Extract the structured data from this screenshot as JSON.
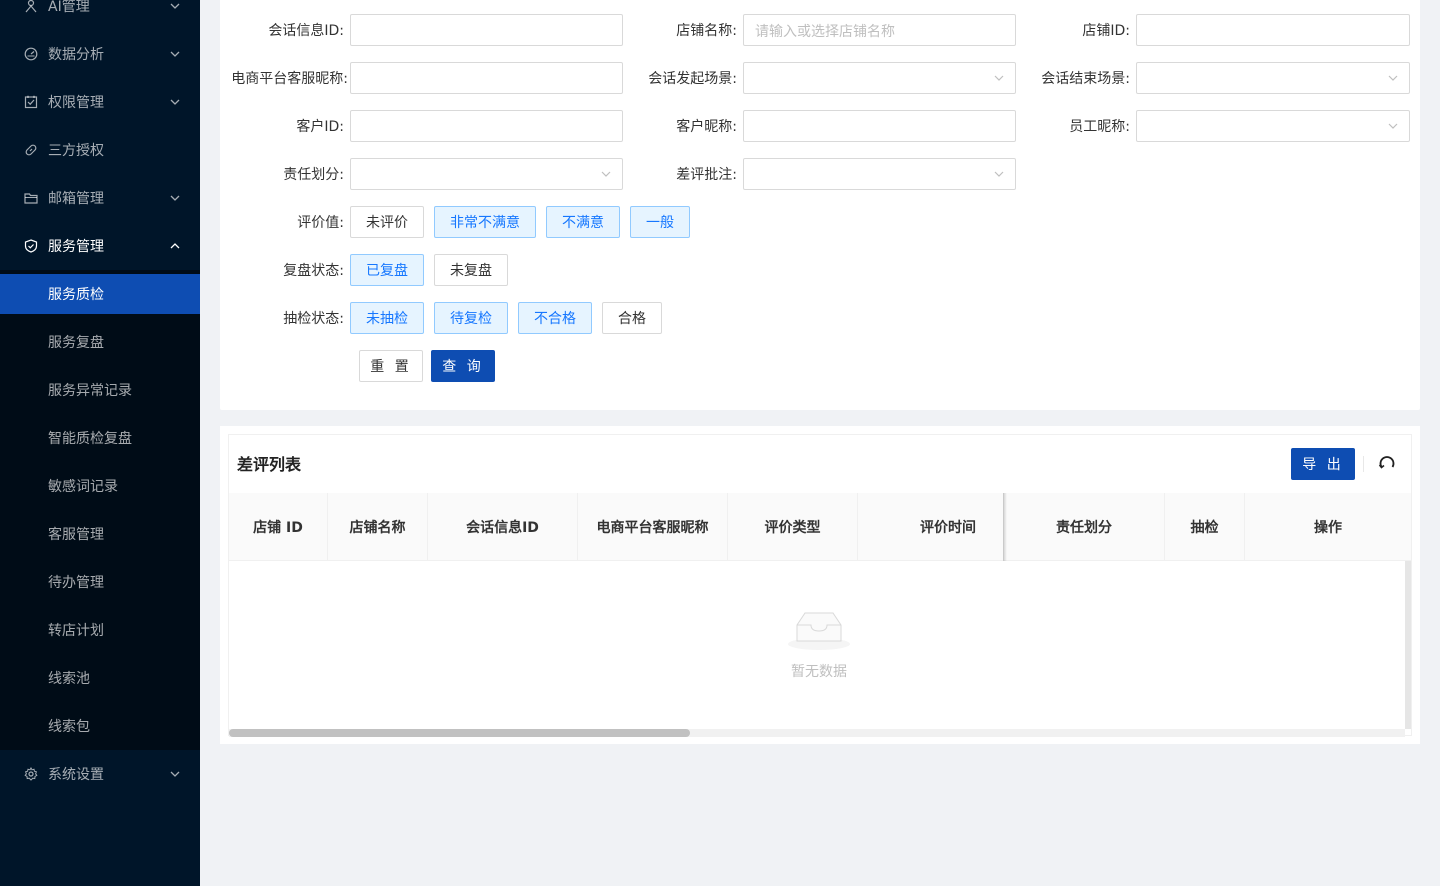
{
  "sidebar": {
    "menus": [
      {
        "label": "AI管理",
        "icon": "ai-icon"
      },
      {
        "label": "数据分析",
        "icon": "dashboard-icon"
      },
      {
        "label": "权限管理",
        "icon": "checkbox-icon"
      },
      {
        "label": "三方授权",
        "icon": "link-icon"
      },
      {
        "label": "邮箱管理",
        "icon": "folder-icon"
      },
      {
        "label": "服务管理",
        "icon": "shield-icon"
      },
      {
        "label": "系统设置",
        "icon": "gear-icon"
      }
    ],
    "service_items": [
      "服务质检",
      "服务复盘",
      "服务异常记录",
      "智能质检复盘",
      "敏感词记录",
      "客服管理",
      "待办管理",
      "转店计划",
      "线索池",
      "线索包"
    ],
    "active_item": "服务质检"
  },
  "search": {
    "session_id_label": "会话信息ID:",
    "shop_name_label": "店铺名称:",
    "shop_name_placeholder": "请输入或选择店铺名称",
    "shop_id_label": "店铺ID:",
    "platform_cs_nick_label": "电商平台客服昵称:",
    "start_scene_label": "会话发起场景:",
    "end_scene_label": "会话结束场景:",
    "customer_id_label": "客户ID:",
    "customer_nick_label": "客户昵称:",
    "staff_nick_label": "员工昵称:",
    "responsibility_label": "责任划分:",
    "bad_review_note_label": "差评批注:",
    "rating_label": "评价值:",
    "rating_options": [
      "未评价",
      "非常不满意",
      "不满意",
      "一般"
    ],
    "review_status_label": "复盘状态:",
    "review_options": [
      "已复盘",
      "未复盘"
    ],
    "sampling_label": "抽检状态:",
    "sampling_options": [
      "未抽检",
      "待复检",
      "不合格",
      "合格"
    ],
    "reset_label": "重 置",
    "query_label": "查 询"
  },
  "table": {
    "title": "差评列表",
    "export_label": "导 出",
    "columns": [
      "店铺 ID",
      "店铺名称",
      "会话信息ID",
      "电商平台客服昵称",
      "评价类型",
      "评价时间",
      "责任划分",
      "抽检",
      "操作"
    ],
    "empty_text": "暂无数据"
  },
  "colors": {
    "sidebar_bg": "#001529",
    "submenu_bg": "#000c17",
    "primary": "#0e4db2",
    "selected_tag_bg": "#e6f4ff",
    "selected_tag_text": "#1677ff"
  }
}
